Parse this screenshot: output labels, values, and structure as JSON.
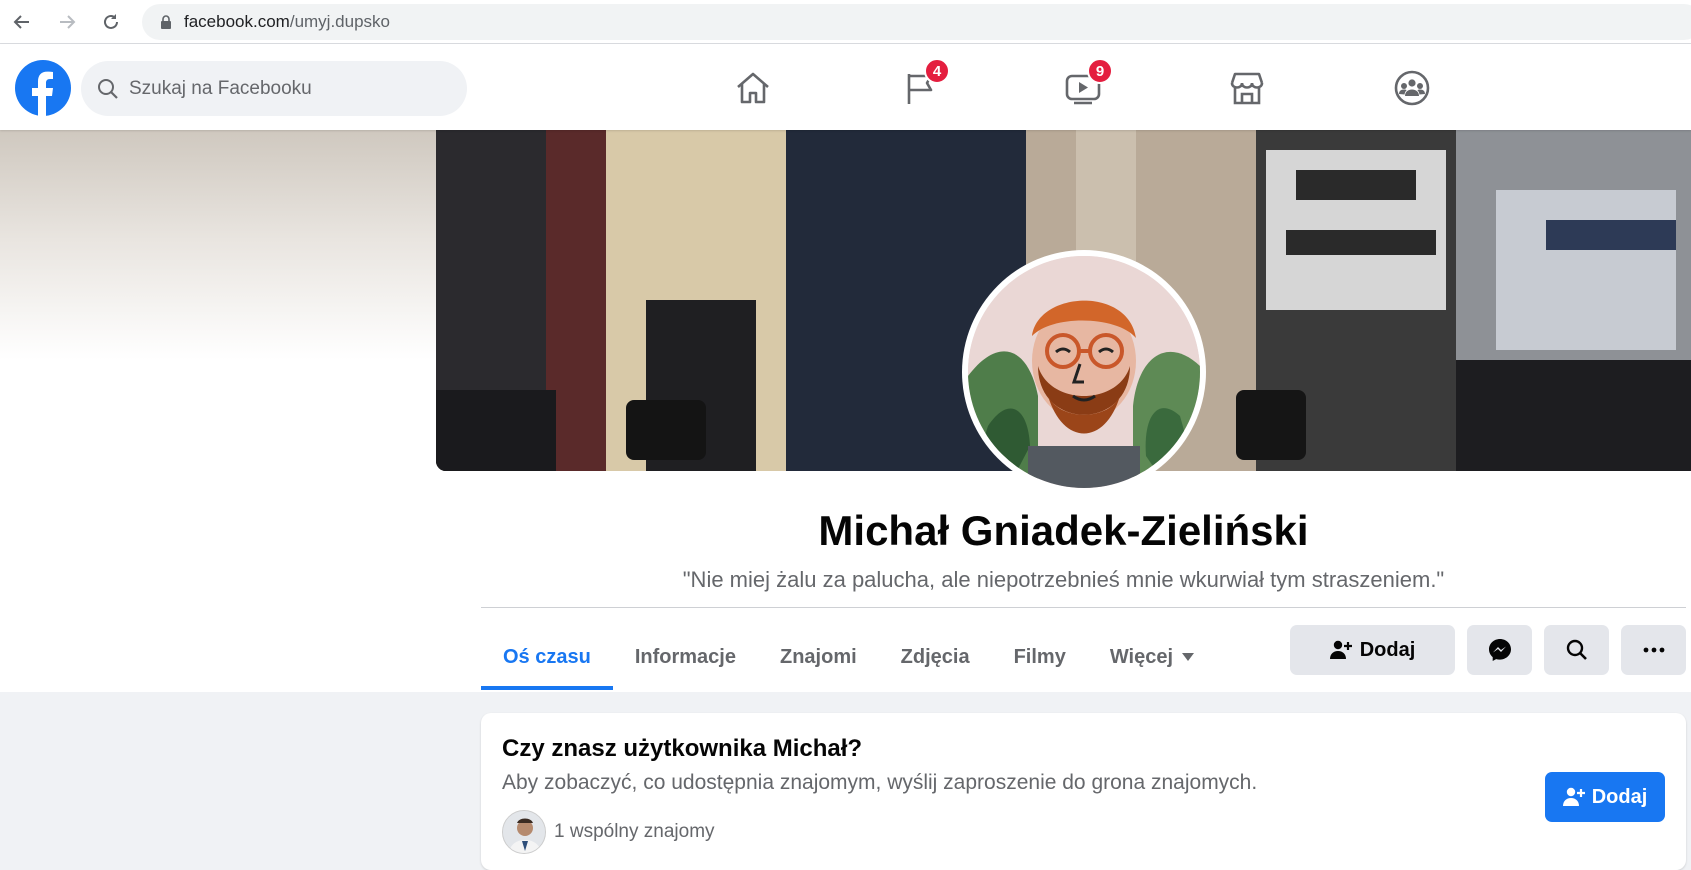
{
  "browser": {
    "url_domain": "facebook.com",
    "url_path": "/umyj.dupsko"
  },
  "header": {
    "search_placeholder": "Szukaj na Facebooku",
    "nav": [
      {
        "icon": "home-icon"
      },
      {
        "icon": "pages-flag-icon",
        "badge": "4"
      },
      {
        "icon": "watch-video-icon",
        "badge": "9"
      },
      {
        "icon": "marketplace-icon"
      },
      {
        "icon": "groups-icon"
      }
    ]
  },
  "profile": {
    "name": "Michał Gniadek-Zieliński",
    "bio": "\"Nie miej żalu za palucha, ale niepotrzebnieś mnie wkurwiał tym straszeniem.\""
  },
  "tabs": [
    {
      "label": "Oś czasu",
      "active": true
    },
    {
      "label": "Informacje"
    },
    {
      "label": "Znajomi"
    },
    {
      "label": "Zdjęcia"
    },
    {
      "label": "Filmy"
    },
    {
      "label": "Więcej"
    }
  ],
  "actions": {
    "add_label": "Dodaj"
  },
  "card": {
    "title": "Czy znasz użytkownika Michał?",
    "subtitle": "Aby zobaczyć, co udostępnia znajomym, wyślij zaproszenie do grona znajomych.",
    "mutual": "1 wspólny znajomy",
    "add_label": "Dodaj"
  },
  "colors": {
    "accent": "#1877f2",
    "badge": "#e41e3f",
    "tab_inactive": "#65676b"
  }
}
